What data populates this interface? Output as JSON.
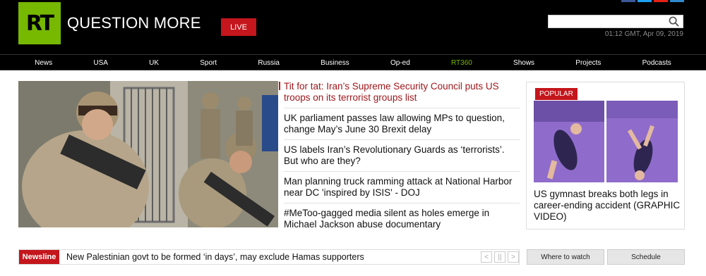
{
  "header": {
    "logo_text": "RT",
    "tagline": "QUESTION MORE",
    "live_label": "LIVE",
    "search_placeholder": "",
    "datetime": "01:12 GMT, Apr 09, 2019"
  },
  "nav": {
    "items": [
      "News",
      "USA",
      "UK",
      "Sport",
      "Russia",
      "Business",
      "Op-ed",
      "RT360",
      "Shows",
      "Projects",
      "Podcasts"
    ]
  },
  "main": {
    "headlines": [
      "Tit for tat: Iran’s Supreme Security Council puts US troops on its terrorist groups list",
      "UK parliament passes law allowing MPs to question, change May’s June 30 Brexit delay",
      "US labels Iran’s Revolutionary Guards as ‘terrorists’. But who are they?",
      "Man planning truck ramming attack at National Harbor near DC 'inspired by ISIS' - DOJ",
      "#MeToo-gagged media silent as holes emerge in Michael Jackson abuse documentary"
    ]
  },
  "popular": {
    "badge": "POPULAR",
    "title": "US gymnast breaks both legs in career-ending accident (GRAPHIC VIDEO)"
  },
  "newsline": {
    "badge": "Newsline",
    "text": "New Palestinian govt to be formed ‘in days’, may exclude Hamas supporters",
    "prev": "<",
    "pause": "||",
    "next": ">"
  },
  "buttons": {
    "where_to_watch": "Where to watch",
    "schedule": "Schedule"
  },
  "colors": {
    "brand_green": "#77b800",
    "brand_red": "#c4161c"
  }
}
